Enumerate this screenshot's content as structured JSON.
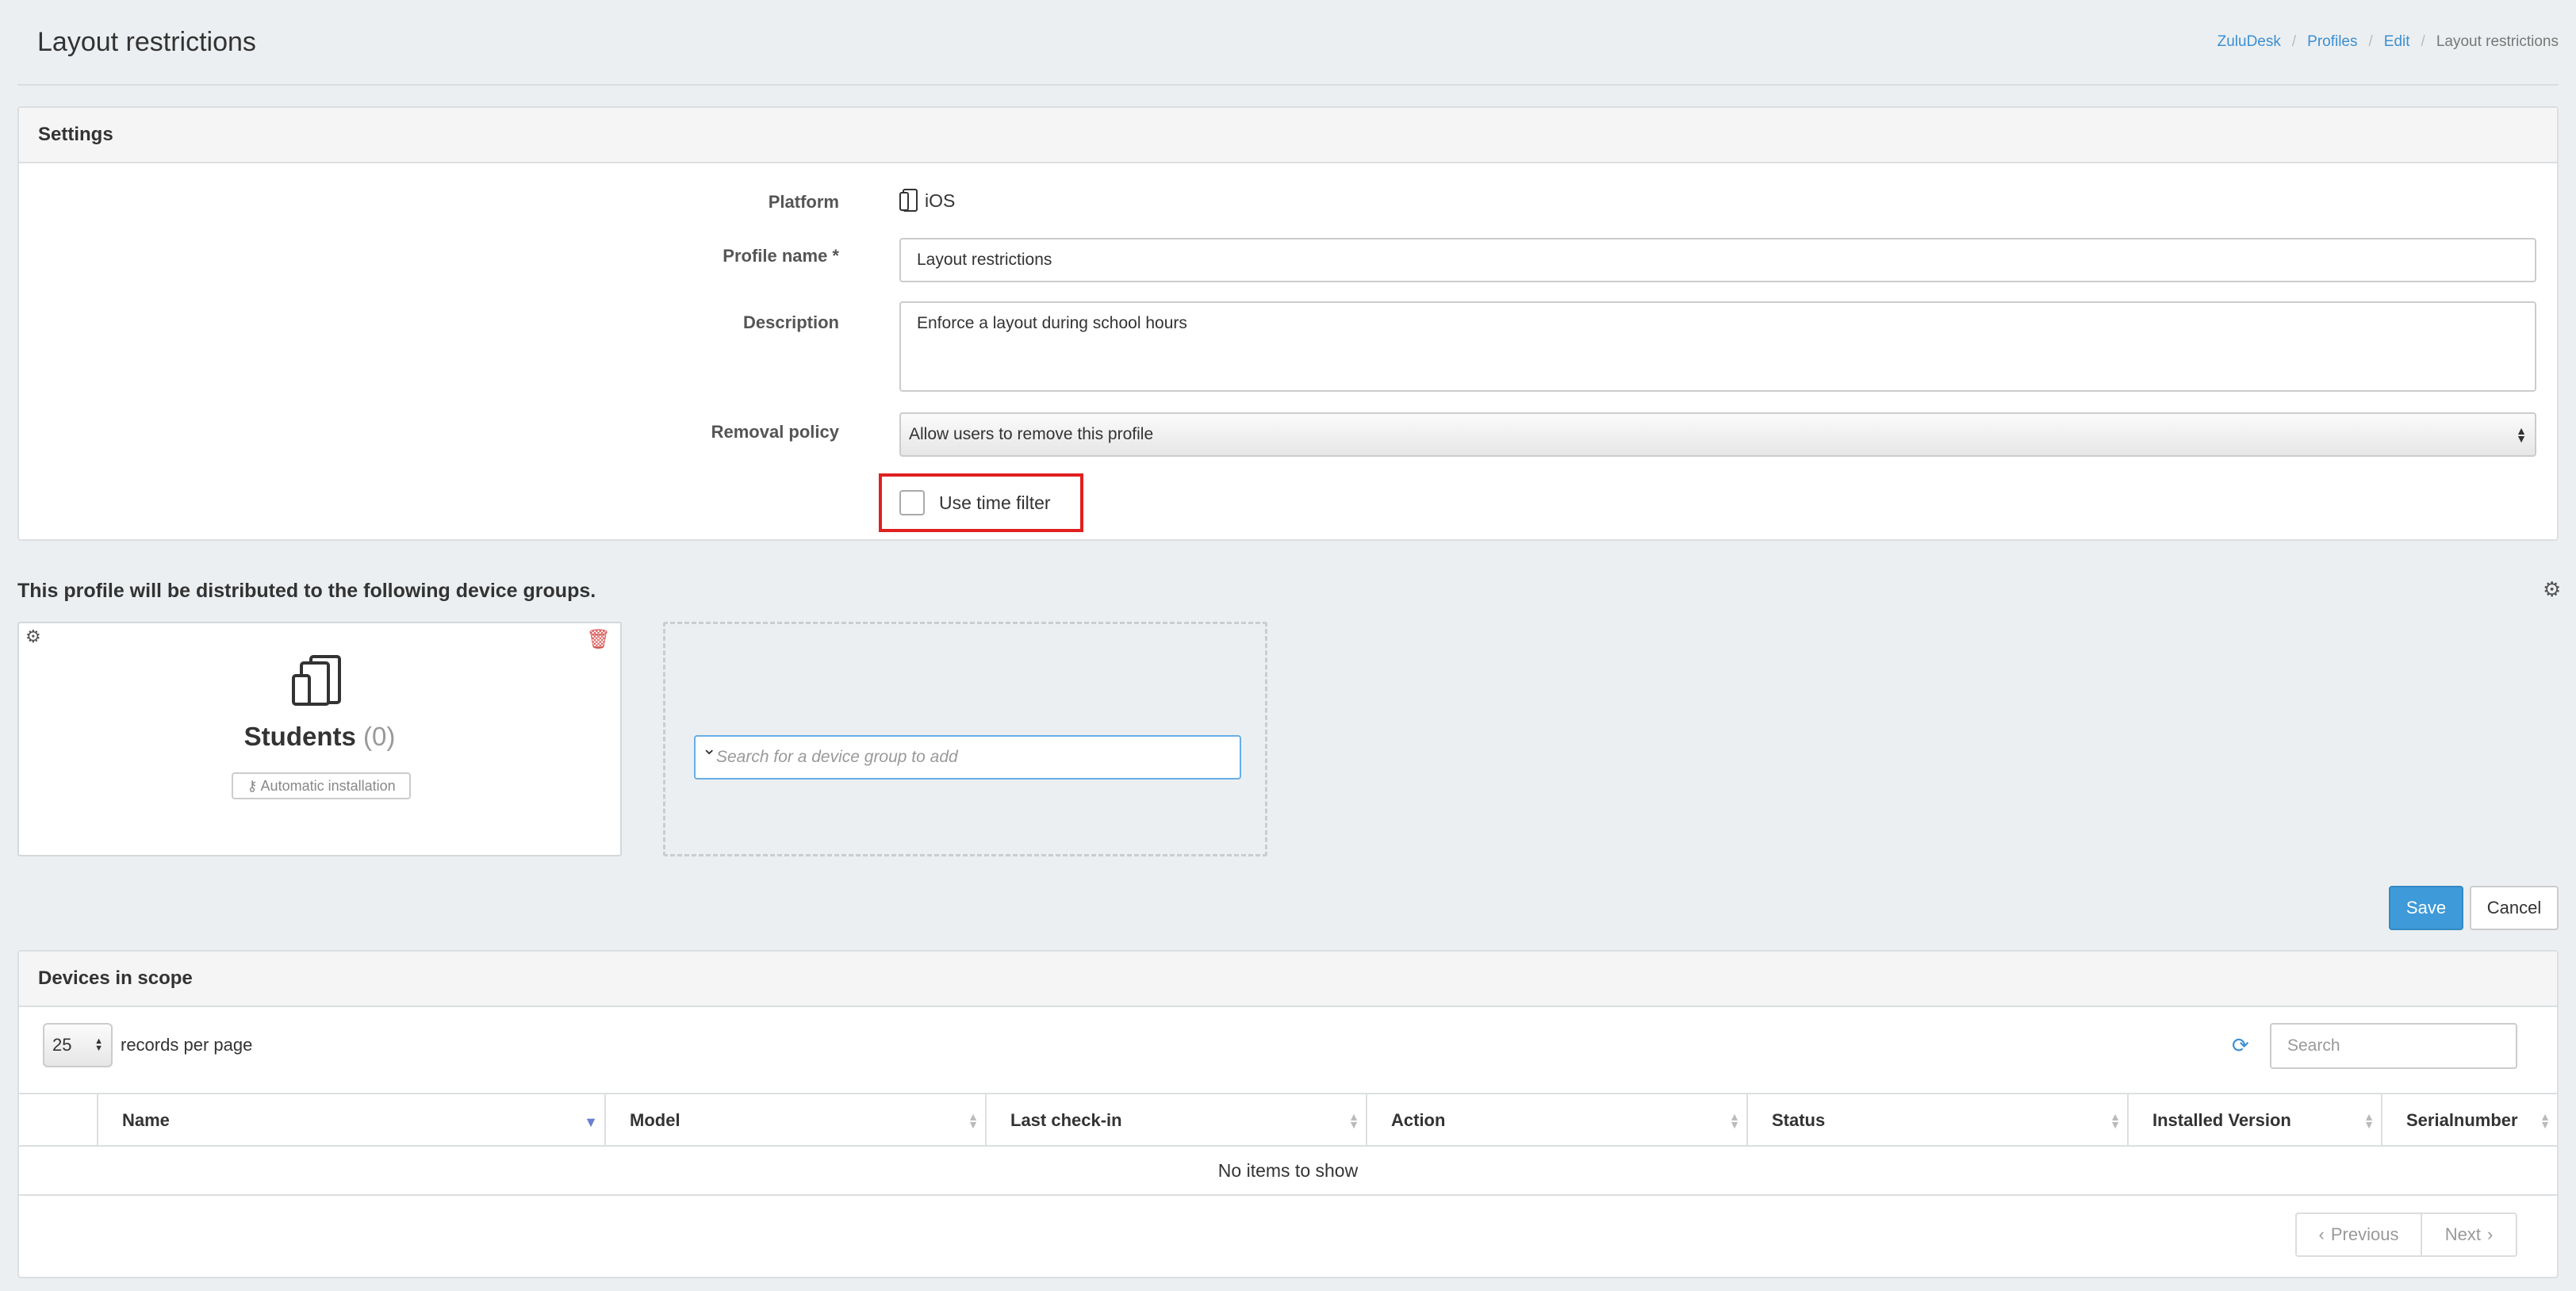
{
  "header": {
    "title": "Layout restrictions",
    "breadcrumb": [
      "ZuluDesk",
      "Profiles",
      "Edit",
      "Layout restrictions"
    ]
  },
  "settings": {
    "heading": "Settings",
    "platform_label": "Platform",
    "platform_value": "iOS",
    "profile_name_label": "Profile name *",
    "profile_name_value": "Layout restrictions",
    "description_label": "Description",
    "description_value": "Enforce a layout during school hours",
    "removal_label": "Removal policy",
    "removal_value": "Allow users to remove this profile",
    "time_filter_label": "Use time filter",
    "time_filter_checked": false
  },
  "groups": {
    "section_title": "This profile will be distributed to the following device groups.",
    "card": {
      "name": "Students",
      "count": "(0)",
      "install_badge": "Automatic installation"
    },
    "search_placeholder": "Search for a device group to add"
  },
  "actions": {
    "save": "Save",
    "cancel": "Cancel"
  },
  "devices": {
    "heading": "Devices in scope",
    "per_page": "25",
    "per_page_label": "records per page",
    "search_placeholder": "Search",
    "columns": [
      "Name",
      "Model",
      "Last check-in",
      "Action",
      "Status",
      "Installed Version",
      "Serialnumber"
    ],
    "empty_text": "No items to show",
    "prev": "Previous",
    "next": "Next"
  }
}
